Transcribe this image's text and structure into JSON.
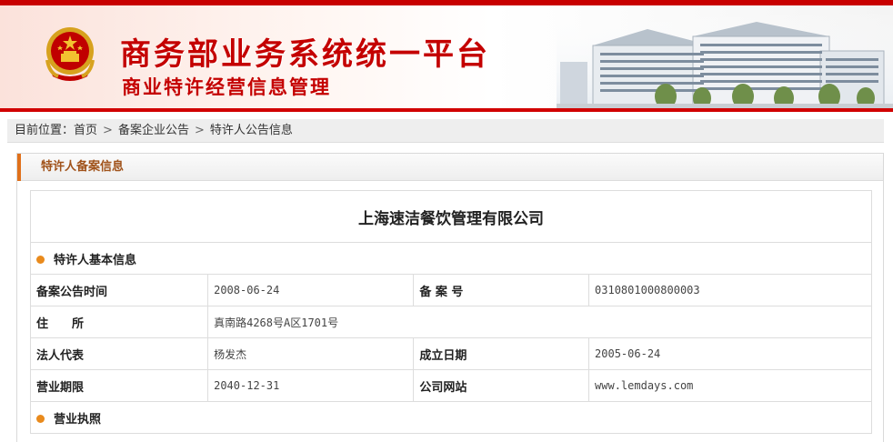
{
  "header": {
    "site_title": "商务部业务系统统一平台",
    "site_subtitle": "商业特许经营信息管理"
  },
  "breadcrumb": {
    "prefix": "目前位置：",
    "items": [
      "首页",
      "备案企业公告",
      "特许人公告信息"
    ]
  },
  "panel": {
    "title": "特许人备案信息",
    "company_name": "上海速洁餐饮管理有限公司",
    "sections": {
      "basic": "特许人基本信息",
      "license": "营业执照"
    },
    "fields": {
      "announce_date_label": "备案公告时间",
      "announce_date_value": "2008-06-24",
      "record_no_label": "备 案 号",
      "record_no_value": "0310801000800003",
      "address_label": "住　　所",
      "address_value": "真南路4268号A区1701号",
      "legal_rep_label": "法人代表",
      "legal_rep_value": "杨发杰",
      "founded_label": "成立日期",
      "founded_value": "2005-06-24",
      "term_label": "营业期限",
      "term_value": "2040-12-31",
      "website_label": "公司网站",
      "website_value": "www.lemdays.com"
    }
  },
  "colors": {
    "brand_red": "#c40000",
    "accent_orange": "#e0701a",
    "bullet_orange": "#e98a1c"
  }
}
